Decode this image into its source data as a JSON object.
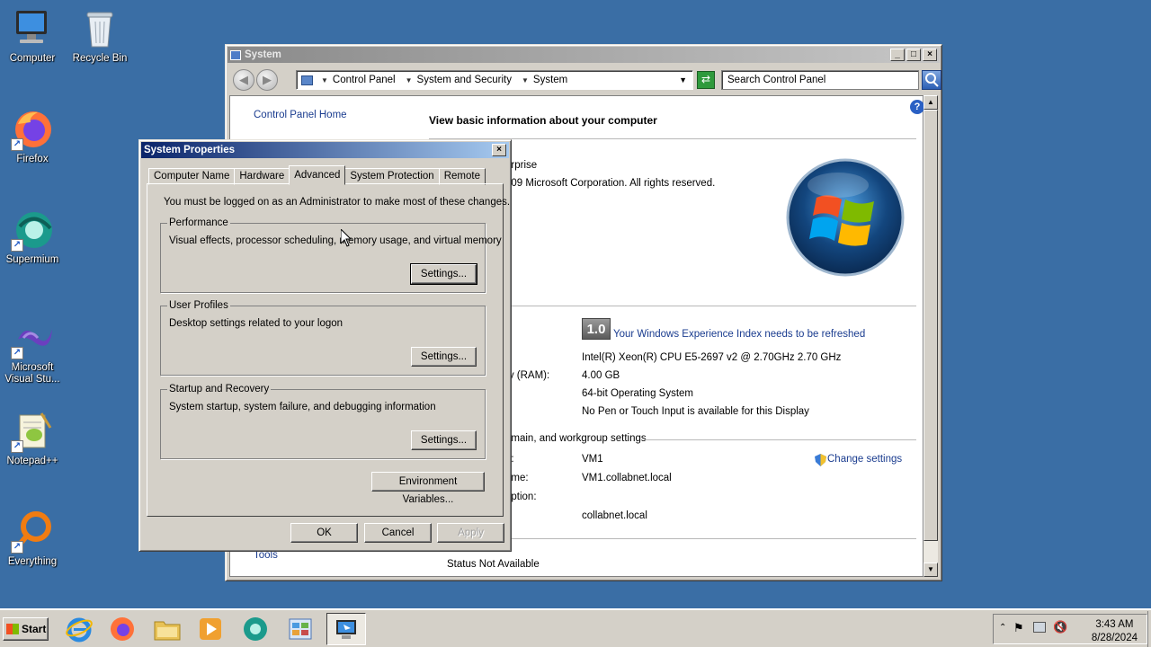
{
  "desktop": {
    "icons": [
      {
        "label": "Computer"
      },
      {
        "label": "Recycle Bin"
      },
      {
        "label": "Firefox"
      },
      {
        "label": "Supermium"
      },
      {
        "label": "Microsoft Visual Stu..."
      },
      {
        "label": "Notepad++"
      },
      {
        "label": "Everything"
      }
    ]
  },
  "system_window": {
    "title": "System",
    "breadcrumbs": [
      "Control Panel",
      "System and Security",
      "System"
    ],
    "search_placeholder": "Search Control Panel",
    "sidebar_link": "Control Panel Home",
    "heading": "View basic information about your computer",
    "edition_fragment": "erprise",
    "copyright_fragment": "009 Microsoft Corporation.  All rights reserved.",
    "rating_badge": "1.0",
    "rating_link": "Your Windows Experience Index needs to be refreshed",
    "processor": "Intel(R) Xeon(R) CPU E5-2697 v2 @ 2.70GHz   2.70 GHz",
    "ram_label_fragment": "ry (RAM):",
    "ram_value": "4.00 GB",
    "system_type": "64-bit Operating System",
    "pen_touch": "No Pen or Touch Input is available for this Display",
    "domain_section_fragment": "omain, and workgroup settings",
    "change_settings": "Change settings",
    "computer_name_label_fragment": "e:",
    "computer_name": "VM1",
    "full_name_label_fragment": "ame:",
    "full_name": "VM1.collabnet.local",
    "description_label_fragment": "ription:",
    "domain": "collabnet.local",
    "tools_link": "Tools",
    "status": "Status Not Available"
  },
  "properties_dialog": {
    "title": "System Properties",
    "tabs": [
      "Computer Name",
      "Hardware",
      "Advanced",
      "System Protection",
      "Remote"
    ],
    "selected_tab": "Advanced",
    "admin_note": "You must be logged on as an Administrator to make most of these changes.",
    "groups": [
      {
        "title": "Performance",
        "desc": "Visual effects, processor scheduling, memory usage, and virtual memory",
        "button": "Settings..."
      },
      {
        "title": "User Profiles",
        "desc": "Desktop settings related to your logon",
        "button": "Settings..."
      },
      {
        "title": "Startup and Recovery",
        "desc": "System startup, system failure, and debugging information",
        "button": "Settings..."
      }
    ],
    "env_button": "Environment Variables...",
    "ok": "OK",
    "cancel": "Cancel",
    "apply": "Apply"
  },
  "taskbar": {
    "start": "Start",
    "time": "3:43 AM",
    "date": "8/28/2024"
  },
  "colors": {
    "desktop": "#3a6ea5",
    "link": "#1a3c8f",
    "active_title": "#0a246a"
  }
}
